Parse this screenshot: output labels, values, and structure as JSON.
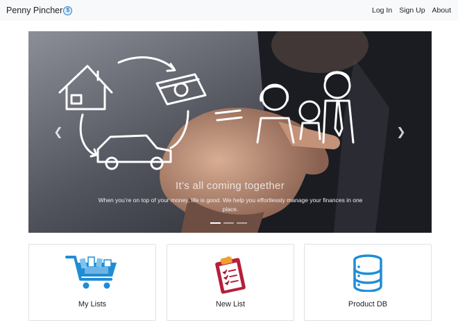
{
  "brand": {
    "name": "Penny Pincher",
    "coin_symbol": "$"
  },
  "nav": {
    "login": "Log In",
    "signup": "Sign Up",
    "about": "About"
  },
  "carousel": {
    "title": "It’s all coming together",
    "text": "When you’re on top of your money, life is good. We help you effortlessly manage your finances in one place.",
    "prev_icon": "chevron-left-icon",
    "next_icon": "chevron-right-icon",
    "slide_count": 3,
    "active_slide": 1
  },
  "cards": [
    {
      "label": "My Lists",
      "icon": "shopping-cart-icon"
    },
    {
      "label": "New List",
      "icon": "clipboard-icon"
    },
    {
      "label": "Product DB",
      "icon": "database-icon"
    }
  ],
  "colors": {
    "navbar_bg": "#f8f9fa",
    "accent_blue": "#1f8dd6",
    "clipboard_red": "#b51f3c",
    "clipboard_orange": "#f0a02c"
  }
}
